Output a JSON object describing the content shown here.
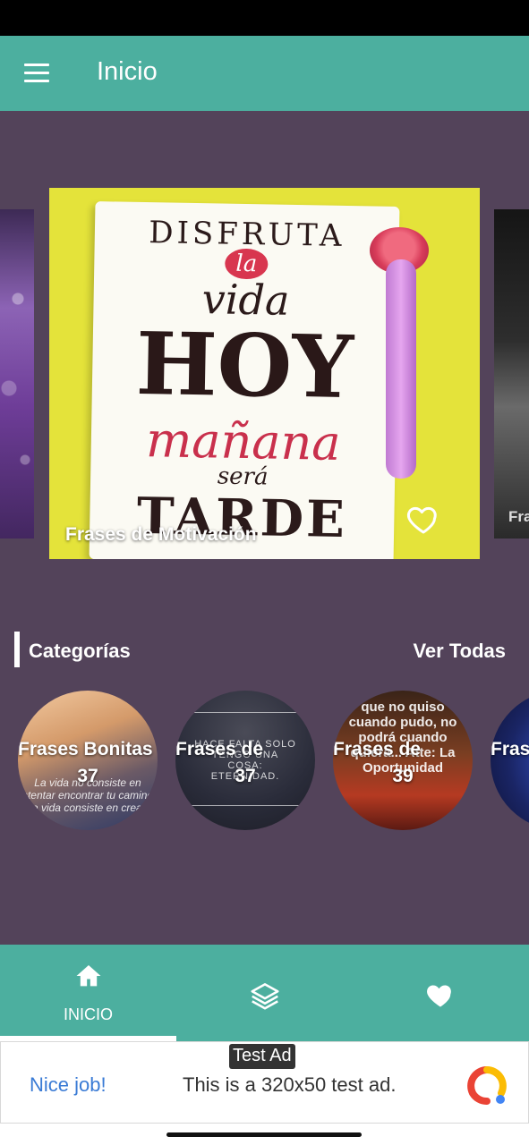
{
  "app_bar": {
    "title": "Inicio",
    "menu_icon": "hamburger-menu-icon"
  },
  "carousel": {
    "main_card": {
      "label": "Frases de Motivación",
      "image_lines": [
        "DISFRUTA",
        "la",
        "vida",
        "HOY",
        "mañana",
        "será",
        "TARDE"
      ],
      "favorite_icon": "heart-outline-icon"
    },
    "right_card_label": "Fra"
  },
  "categories_section": {
    "title": "Categorías",
    "see_all": "Ver Todas",
    "items": [
      {
        "label": "Frases Bonitas",
        "count": "37",
        "image_text": "La vida no consiste en intentar encontrar tu camino, la vida consiste en crear"
      },
      {
        "label": "Frases de",
        "count": "37",
        "image_text": "HACE FALTA SOLO TENGO UNA COSA: ETERNIDAD."
      },
      {
        "label": "Frases de",
        "count": "39",
        "image_text": "que no quiso cuando pudo, no podrá cuando quiera... Atte: La Oportunidad"
      },
      {
        "label": "Fras",
        "count": "",
        "image_text": ""
      }
    ]
  },
  "bottom_nav": {
    "items": [
      {
        "label": "INICIO",
        "icon": "home-icon",
        "active": true
      },
      {
        "label": "",
        "icon": "layers-icon",
        "active": false
      },
      {
        "label": "",
        "icon": "heart-icon",
        "active": false
      }
    ]
  },
  "ad": {
    "badge": "Test Ad",
    "nice": "Nice job!",
    "text": "This is a 320x50 test ad.",
    "logo_icon": "admob-logo-icon"
  }
}
